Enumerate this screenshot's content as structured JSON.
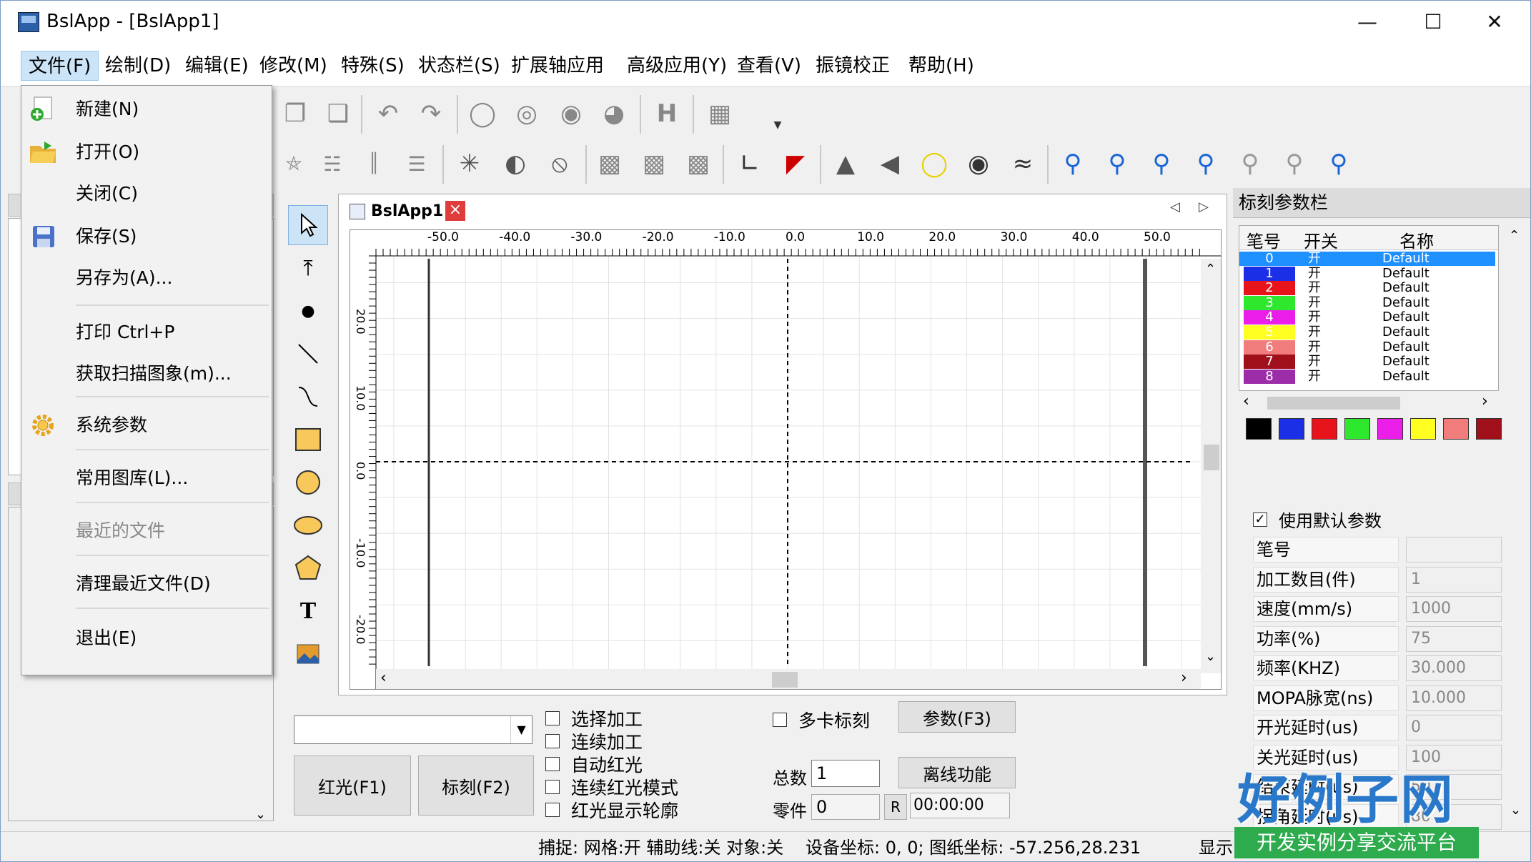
{
  "window": {
    "title": "BslApp - [BslApp1]"
  },
  "menubar": [
    "文件(F)",
    "绘制(D)",
    "编辑(E)",
    "修改(M)",
    "特殊(S)",
    "状态栏(S)",
    "扩展轴应用",
    "高级应用(Y)",
    "查看(V)",
    "振镜校正",
    "帮助(H)"
  ],
  "file_menu": {
    "new": "新建(N)",
    "open": "打开(O)",
    "close": "关闭(C)",
    "save": "保存(S)",
    "save_as": "另存为(A)...",
    "print": "打印 Ctrl+P",
    "acquire": "获取扫描图象(m)...",
    "sys_params": "系统参数",
    "library": "常用图库(L)...",
    "recent": "最近的文件",
    "clear_recent": "清理最近文件(D)",
    "exit": "退出(E)"
  },
  "doc_tab": {
    "title": "BslApp1",
    "close": "×"
  },
  "ruler": {
    "x_ticks": [
      "-50.0",
      "-40.0",
      "-30.0",
      "-20.0",
      "-10.0",
      "0.0",
      "10.0",
      "20.0",
      "30.0",
      "40.0",
      "50.0"
    ],
    "y_ticks": [
      "20.0",
      "10.0",
      "0.0",
      "-10.0",
      "-20.0"
    ]
  },
  "bottom": {
    "red_light": "红光(F1)",
    "mark": "标刻(F2)",
    "checks": [
      "选择加工",
      "连续加工",
      "自动红光",
      "连续红光模式",
      "红光显示轮廓"
    ],
    "multi_card": "多卡标刻",
    "params_btn": "参数(F3)",
    "offline_btn": "离线功能",
    "total_label": "总数",
    "total_value": "1",
    "part_label": "零件",
    "part_value": "0",
    "r_btn": "R",
    "time": "00:00:00"
  },
  "right_panel": {
    "title": "标刻参数栏",
    "headers": [
      "笔号",
      "开关",
      "名称"
    ],
    "pens": [
      {
        "no": "0",
        "on": "开",
        "name": "Default",
        "color": "#1e90ff"
      },
      {
        "no": "1",
        "on": "开",
        "name": "Default",
        "color": "#1a2fe6"
      },
      {
        "no": "2",
        "on": "开",
        "name": "Default",
        "color": "#e8141c"
      },
      {
        "no": "3",
        "on": "开",
        "name": "Default",
        "color": "#2ee82e"
      },
      {
        "no": "4",
        "on": "开",
        "name": "Default",
        "color": "#ea1ee8"
      },
      {
        "no": "5",
        "on": "开",
        "name": "Default",
        "color": "#ffff22"
      },
      {
        "no": "6",
        "on": "开",
        "name": "Default",
        "color": "#f07c7c"
      },
      {
        "no": "7",
        "on": "开",
        "name": "Default",
        "color": "#a0101a"
      },
      {
        "no": "8",
        "on": "开",
        "name": "Default",
        "color": "#9c2ca8"
      }
    ],
    "swatches": [
      "#000000",
      "#1a2fe6",
      "#e8141c",
      "#2ee82e",
      "#ea1ee8",
      "#ffff22",
      "#f07c7c",
      "#a0101a"
    ],
    "use_default": "使用默认参数",
    "params": [
      {
        "label": "笔号",
        "value": ""
      },
      {
        "label": "加工数目(件)",
        "value": "1"
      },
      {
        "label": "速度(mm/s)",
        "value": "1000"
      },
      {
        "label": "功率(%)",
        "value": "75"
      },
      {
        "label": "频率(KHZ)",
        "value": "30.000"
      },
      {
        "label": "MOPA脉宽(ns)",
        "value": "10.000"
      },
      {
        "label": "开光延时(us)",
        "value": "0"
      },
      {
        "label": "关光延时(us)",
        "value": "100"
      },
      {
        "label": "结束延时(us)",
        "value": "50"
      },
      {
        "label": "拐角延时(us)",
        "value": "80"
      }
    ]
  },
  "status": {
    "capture": "捕捉: 网格:开 辅助线:关 对象:关",
    "coords": "设备坐标: 0, 0; 图纸坐标: -57.256,28.231",
    "show": "显示"
  },
  "badge": {
    "main": "好例子网",
    "sub": "开发实例分享交流平台"
  }
}
